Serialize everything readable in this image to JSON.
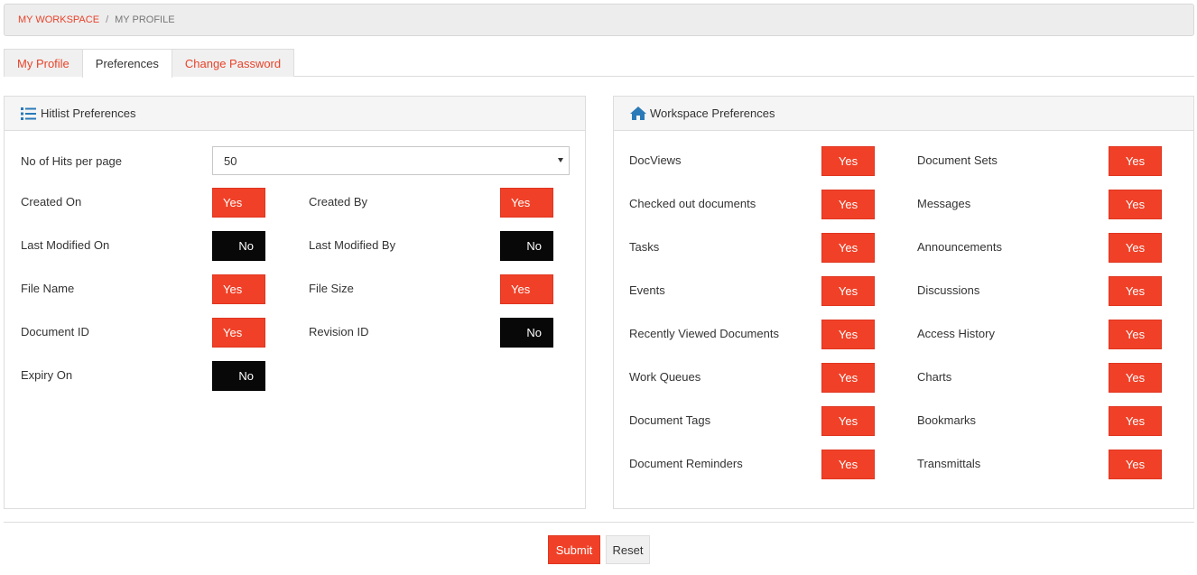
{
  "breadcrumb": {
    "workspace": "MY WORKSPACE",
    "separator": "/",
    "current": "MY PROFILE"
  },
  "tabs": [
    {
      "label": "My Profile",
      "active": false
    },
    {
      "label": "Preferences",
      "active": true
    },
    {
      "label": "Change Password",
      "active": false
    }
  ],
  "hitlist": {
    "title": "Hitlist Preferences",
    "icon": "list-icon",
    "hits_label": "No of Hits per page",
    "hits_value": "50",
    "items": [
      {
        "label": "Created On",
        "value": "Yes"
      },
      {
        "label": "Created By",
        "value": "Yes"
      },
      {
        "label": "Last Modified On",
        "value": "No"
      },
      {
        "label": "Last Modified By",
        "value": "No"
      },
      {
        "label": "File Name",
        "value": "Yes"
      },
      {
        "label": "File Size",
        "value": "Yes"
      },
      {
        "label": "Document ID",
        "value": "Yes"
      },
      {
        "label": "Revision ID",
        "value": "No"
      },
      {
        "label": "Expiry On",
        "value": "No"
      }
    ]
  },
  "workspace": {
    "title": "Workspace Preferences",
    "icon": "home-icon",
    "items": [
      {
        "label": "DocViews",
        "value": "Yes"
      },
      {
        "label": "Document Sets",
        "value": "Yes"
      },
      {
        "label": "Checked out documents",
        "value": "Yes"
      },
      {
        "label": "Messages",
        "value": "Yes"
      },
      {
        "label": "Tasks",
        "value": "Yes"
      },
      {
        "label": "Announcements",
        "value": "Yes"
      },
      {
        "label": "Events",
        "value": "Yes"
      },
      {
        "label": "Discussions",
        "value": "Yes"
      },
      {
        "label": "Recently Viewed Documents",
        "value": "Yes"
      },
      {
        "label": "Access History",
        "value": "Yes"
      },
      {
        "label": "Work Queues",
        "value": "Yes"
      },
      {
        "label": "Charts",
        "value": "Yes"
      },
      {
        "label": "Document Tags",
        "value": "Yes"
      },
      {
        "label": "Bookmarks",
        "value": "Yes"
      },
      {
        "label": "Document Reminders",
        "value": "Yes"
      },
      {
        "label": "Transmittals",
        "value": "Yes"
      }
    ]
  },
  "actions": {
    "submit": "Submit",
    "reset": "Reset"
  },
  "colors": {
    "accent": "#f04128",
    "off": "#080808"
  }
}
